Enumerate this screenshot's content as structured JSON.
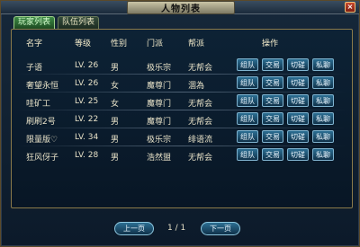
{
  "window": {
    "title": "人物列表",
    "close_label": "×"
  },
  "tabs": [
    {
      "label": "玩家列表",
      "active": true
    },
    {
      "label": "队伍列表",
      "active": false
    }
  ],
  "table": {
    "headers": {
      "name": "名字",
      "level": "等级",
      "gender": "性别",
      "school": "门派",
      "guild": "帮派",
      "ops": "操作"
    },
    "rows": [
      {
        "name": "子语",
        "level": "LV. 26",
        "gender": "男",
        "school": "极乐宗",
        "guild": "无帮会"
      },
      {
        "name": "奢望永恒",
        "level": "LV. 26",
        "gender": "女",
        "school": "魔尊门",
        "guild": "涸為"
      },
      {
        "name": "哇矿工",
        "level": "LV. 25",
        "gender": "女",
        "school": "魔尊门",
        "guild": "无帮会"
      },
      {
        "name": "刷刷2号",
        "level": "LV. 22",
        "gender": "男",
        "school": "魔尊门",
        "guild": "无帮会"
      },
      {
        "name": "限量版♡",
        "level": "LV. 34",
        "gender": "男",
        "school": "极乐宗",
        "guild": "绯语流"
      },
      {
        "name": "狂风伢子",
        "level": "LV. 28",
        "gender": "男",
        "school": "浩然盟",
        "guild": "无帮会"
      }
    ],
    "ops": {
      "team": "组队",
      "trade": "交易",
      "duel": "切磋",
      "chat": "私聊"
    }
  },
  "pager": {
    "prev": "上一页",
    "page": "1 / 1",
    "next": "下一页"
  }
}
